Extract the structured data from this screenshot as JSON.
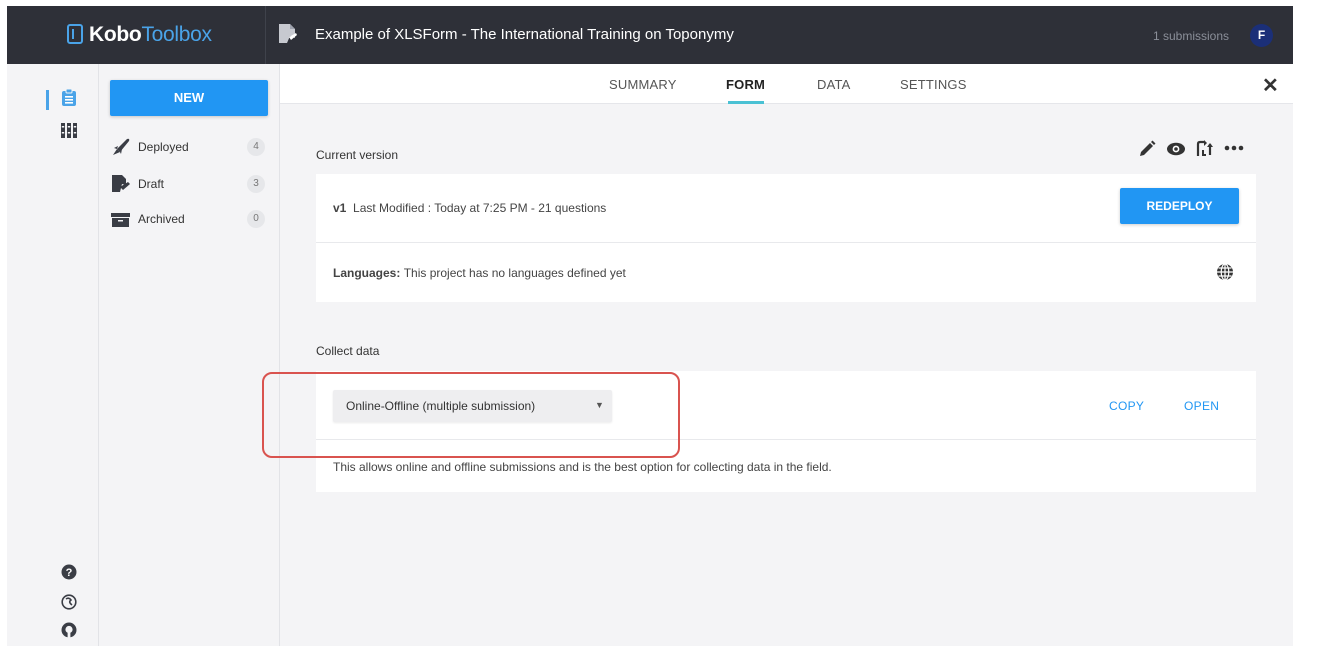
{
  "header": {
    "logo_kobo": "Kobo",
    "logo_toolbox": "Toolbox",
    "project_title": "Example of XLSForm - The International Training on Toponymy",
    "submissions": "1 submissions",
    "avatar_initial": "F"
  },
  "rail": {
    "icons": [
      "projects-icon",
      "library-icon",
      "help-icon",
      "support-icon",
      "github-icon"
    ]
  },
  "sidebar": {
    "new_label": "NEW",
    "items": [
      {
        "label": "Deployed",
        "count": "4",
        "icon": "rocket-icon"
      },
      {
        "label": "Draft",
        "count": "3",
        "icon": "draft-form-icon"
      },
      {
        "label": "Archived",
        "count": "0",
        "icon": "archive-icon"
      }
    ]
  },
  "tabs": [
    {
      "label": "SUMMARY"
    },
    {
      "label": "FORM"
    },
    {
      "label": "DATA"
    },
    {
      "label": "SETTINGS"
    }
  ],
  "form": {
    "current_version_label": "Current version",
    "version": "v1",
    "last_modified": "Last Modified : Today at 7:25 PM - 21 questions",
    "redeploy_label": "REDEPLOY",
    "languages_label": "Languages:",
    "languages_text": "This project has no languages defined yet",
    "collect_label": "Collect data",
    "collect_method": "Online-Offline (multiple submission)",
    "copy_label": "COPY",
    "open_label": "OPEN",
    "collect_description": "This allows online and offline submissions and is the best option for collecting data in the field."
  },
  "colors": {
    "accent": "#2196f3",
    "topbar": "#2e3038",
    "tab_underline": "#4ac1d4",
    "highlight": "#d9534f"
  }
}
